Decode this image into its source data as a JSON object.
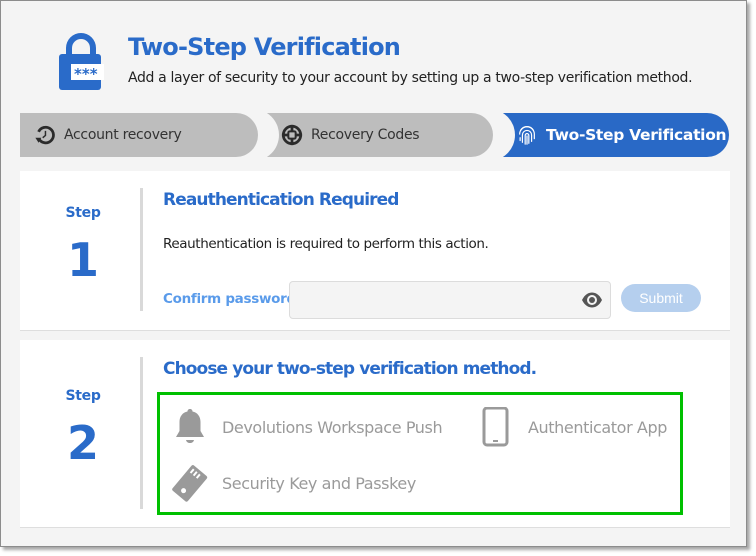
{
  "header": {
    "icon": "lock-password-icon",
    "title": "Two-Step Verification",
    "subtitle": "Add a layer of security to your account by setting up a two-step verification method."
  },
  "tabs": [
    {
      "label": "Account recovery",
      "icon": "history-icon",
      "active": false
    },
    {
      "label": "Recovery Codes",
      "icon": "lifebuoy-icon",
      "active": false
    },
    {
      "label": "Two-Step Verification",
      "icon": "fingerprint-icon",
      "active": true
    }
  ],
  "step1": {
    "step_label": "Step",
    "step_number": "1",
    "title": "Reauthentication Required",
    "description": "Reauthentication is required to perform this action.",
    "password_label": "Confirm password",
    "password_value": "",
    "password_placeholder": "",
    "toggle_icon": "eye-icon",
    "submit_label": "Submit",
    "submit_enabled": false
  },
  "step2": {
    "step_label": "Step",
    "step_number": "2",
    "title": "Choose your two-step verification method.",
    "methods": [
      {
        "label": "Devolutions Workspace Push",
        "icon": "bell-icon"
      },
      {
        "label": "Authenticator App",
        "icon": "smartphone-icon"
      },
      {
        "label": "Security Key and Passkey",
        "icon": "security-key-icon"
      }
    ]
  },
  "colors": {
    "accent": "#2a6bc9",
    "active_tab": "#2969c6",
    "inactive_tab": "#bdbdbd",
    "highlight_box": "#00c000",
    "disabled_button": "#b5cfee",
    "method_text": "#9a9a9a"
  }
}
